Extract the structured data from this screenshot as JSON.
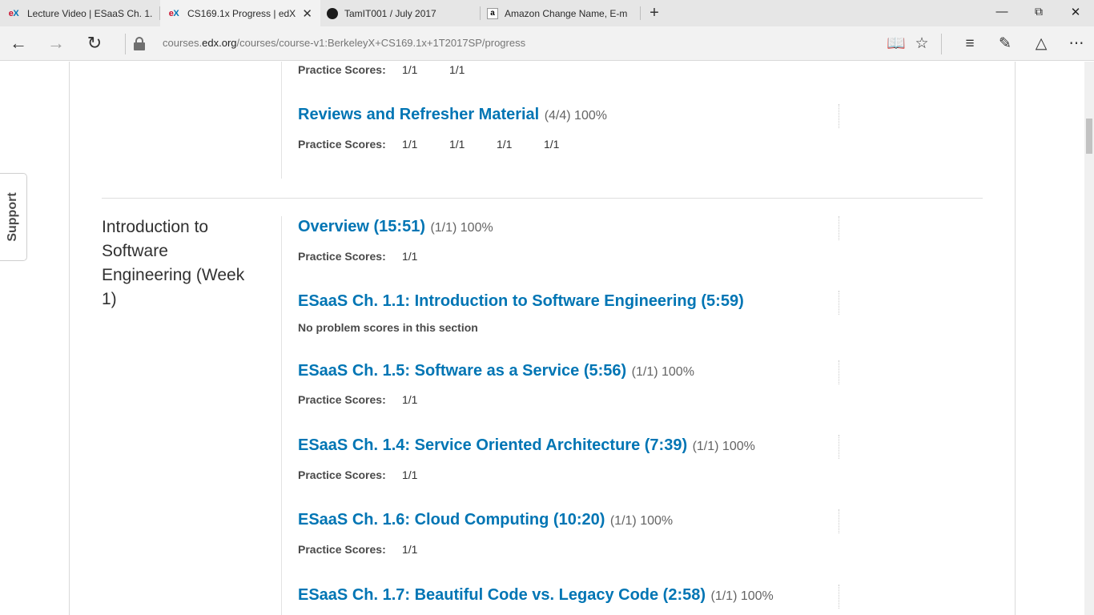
{
  "browser": {
    "tabs": [
      {
        "icon": "edx-favicon",
        "title": "Lecture Video | ESaaS Ch. 1."
      },
      {
        "icon": "edx-favicon",
        "title": "CS169.1x Progress | edX",
        "active": true
      },
      {
        "icon": "github-favicon",
        "title": "TamIT001 / July 2017"
      },
      {
        "icon": "amazon-favicon",
        "title": "Amazon Change Name, E-m"
      }
    ],
    "new_tab": "+",
    "url_domain": "courses.edx.org",
    "url_prefix": "courses.",
    "url_domain_part": "edx.org",
    "url_path": "/courses/course-v1:BerkeleyX+CS169.1x+1T2017SP/progress",
    "window_controls": [
      "minimize",
      "restore",
      "close"
    ]
  },
  "support_label": "Support",
  "chapter": {
    "title": "Introduction to Software Engineering (Week 1)"
  },
  "previous_chapter_sections": [
    {
      "practice_label": "Practice Scores:",
      "scores": [
        "1/1",
        "1/1"
      ]
    },
    {
      "title": "Reviews and Refresher Material",
      "score": "(4/4) 100%",
      "practice_label": "Practice Scores:",
      "scores": [
        "1/1",
        "1/1",
        "1/1",
        "1/1"
      ]
    }
  ],
  "sections": [
    {
      "title": "Overview (15:51)",
      "score": "(1/1) 100%",
      "practice_label": "Practice Scores:",
      "scores": [
        "1/1"
      ]
    },
    {
      "title": "ESaaS Ch. 1.1: Introduction to Software Engineering (5:59)",
      "score": "",
      "no_scores": "No problem scores in this section"
    },
    {
      "title": "ESaaS Ch. 1.5: Software as a Service (5:56)",
      "score": "(1/1) 100%",
      "practice_label": "Practice Scores:",
      "scores": [
        "1/1"
      ]
    },
    {
      "title": "ESaaS Ch. 1.4: Service Oriented Architecture (7:39)",
      "score": "(1/1) 100%",
      "practice_label": "Practice Scores:",
      "scores": [
        "1/1"
      ]
    },
    {
      "title": "ESaaS Ch. 1.6: Cloud Computing (10:20)",
      "score": "(1/1) 100%",
      "practice_label": "Practice Scores:",
      "scores": [
        "1/1"
      ]
    },
    {
      "title": "ESaaS Ch. 1.7: Beautiful Code vs. Legacy Code (2:58)",
      "score": "(1/1) 100%"
    }
  ],
  "colors": {
    "link": "#0075b4",
    "chrome": "#e6e6e6",
    "active_tab": "#f2f2f2"
  }
}
